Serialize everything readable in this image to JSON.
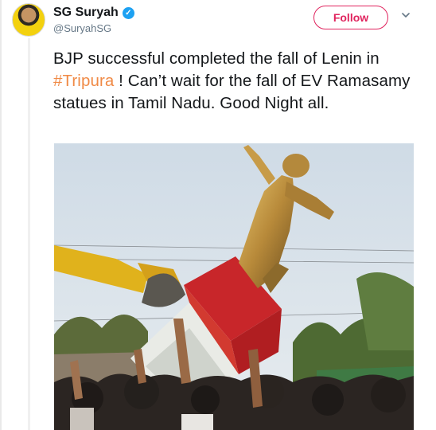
{
  "author": {
    "display_name": "SG Suryah",
    "handle": "@SuryahSG",
    "verified_icon": "verified-badge-icon"
  },
  "actions": {
    "follow_label": "Follow",
    "menu_icon": "chevron-down-icon"
  },
  "tweet": {
    "text_before": "BJP successful completed the fall of Lenin in ",
    "hashtag": "#Tripura",
    "text_after": " ! Can’t wait for the fall of EV Ramasamy statues in Tamil Nadu. Good Night all."
  },
  "colors": {
    "follow_accent": "#e0245e",
    "hashtag": "#f08a46",
    "verified": "#1da1f2"
  }
}
